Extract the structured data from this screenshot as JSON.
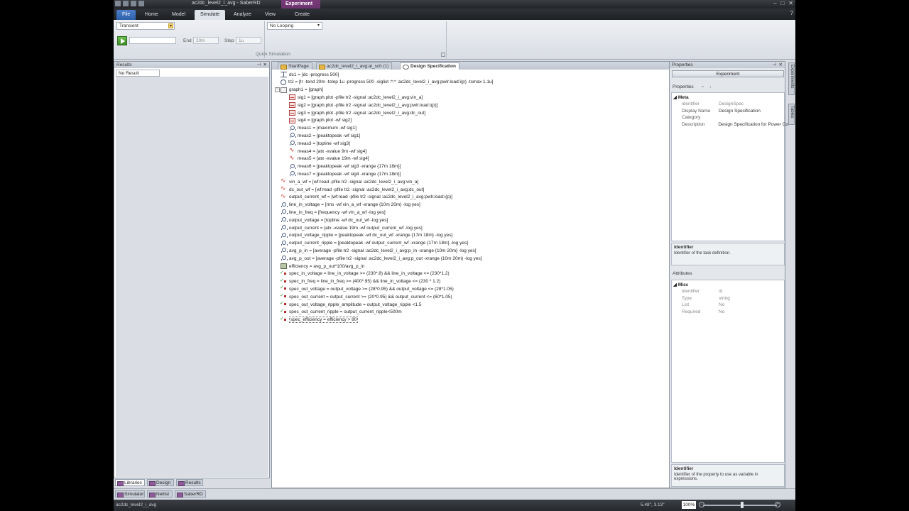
{
  "window": {
    "title": "ac2dc_level2_i_avg - SaberRD",
    "context_tab": "Experiment"
  },
  "ribbon_tabs": [
    {
      "label": "File"
    },
    {
      "label": "Home"
    },
    {
      "label": "Model"
    },
    {
      "label": "Simulate"
    },
    {
      "label": "Analyze"
    },
    {
      "label": "View"
    },
    {
      "label": "Create"
    }
  ],
  "ribbon": {
    "analysis_type": "Transient",
    "looping": "No Looping",
    "end_label": "End",
    "end_placeholder": "20m",
    "step_label": "Step",
    "step_placeholder": "1u",
    "group_label": "Quick Simulation"
  },
  "results": {
    "title": "Results",
    "tab": "No Result"
  },
  "bottom_tabs": [
    {
      "label": "Libraries"
    },
    {
      "label": "Design"
    },
    {
      "label": "Results"
    }
  ],
  "mode_tabs": [
    {
      "label": "Simulator"
    },
    {
      "label": "Netlist"
    },
    {
      "label": "SaberRD"
    }
  ],
  "doc_tabs": [
    {
      "label": "StartPage"
    },
    {
      "label": "ac2dc_level2_i_avg:ai_sch (1)"
    },
    {
      "label": "Design Specification"
    }
  ],
  "tree": [
    {
      "indent": 0,
      "icon": "dc",
      "text": "dc1 = [dc -progress 500]"
    },
    {
      "indent": 0,
      "icon": "tr",
      "text": "tr2 = [tr -tend 20m -tstep 1u -progress 500 -siglist :*:* :ac2dc_level2_i_avg:pwlr.load:i(p) -tsmax 1.1u]"
    },
    {
      "indent": 0,
      "icon": "graph",
      "text": "graph1 = [graph]",
      "expander": "−"
    },
    {
      "indent": 1,
      "icon": "sig",
      "text": "sig1 = [graph.plot -pfile tr2 -signal :ac2dc_level2_i_avg:vin_a]"
    },
    {
      "indent": 1,
      "icon": "sig",
      "text": "sig2 = [graph.plot -pfile tr2 -signal :ac2dc_level2_i_avg:pwlr.load:i(p)]"
    },
    {
      "indent": 1,
      "icon": "sig",
      "text": "sig3 = [graph.plot -pfile tr2 -signal :ac2dc_level2_i_avg:dc_out]"
    },
    {
      "indent": 1,
      "icon": "sig",
      "text": "sig4 = [graph.plot -wf sig2]"
    },
    {
      "indent": 1,
      "icon": "meas",
      "text": "meas1 = [maximum -wf sig1]"
    },
    {
      "indent": 1,
      "icon": "meas",
      "text": "meas2 = [peaktopeak -wf sig1]"
    },
    {
      "indent": 1,
      "icon": "meas",
      "text": "meas3 = [topline -wf sig3]"
    },
    {
      "indent": 1,
      "icon": "wave",
      "text": "meas4 = [atx -xvalue 9m -wf sig4]"
    },
    {
      "indent": 1,
      "icon": "wave",
      "text": "meas5 = [atx -xvalue 19m -wf sig4]"
    },
    {
      "indent": 1,
      "icon": "meas",
      "text": "meas6 = [peaktopeak -wf sig3 -xrange {17m 18m}]"
    },
    {
      "indent": 1,
      "icon": "meas",
      "text": "meas7 = [peaktopeak -wf sig4 -xrange {17m 18m}]"
    },
    {
      "indent": 0,
      "icon": "wave",
      "text": "vin_a_wf = [wf:read -pfile tr2 -signal :ac2dc_level2_i_avg:vin_a]"
    },
    {
      "indent": 0,
      "icon": "wave",
      "text": "dc_out_wf = [wf:read -pfile tr2 -signal :ac2dc_level2_i_avg:dc_out]"
    },
    {
      "indent": 0,
      "icon": "wave",
      "text": "output_current_wf = [wf:read -pfile tr2 -signal :ac2dc_level2_i_avg:pwlr.load:i(p)]"
    },
    {
      "indent": 0,
      "icon": "meas",
      "text": "line_in_voltage = [rms -wf vin_a_wf -xrange {10m 20m} -log yes]"
    },
    {
      "indent": 0,
      "icon": "meas",
      "text": "line_in_freq = [frequency -wf vin_a_wf -log yes]"
    },
    {
      "indent": 0,
      "icon": "meas",
      "text": "output_voltage = [topline -wf dc_out_wf -log yes]"
    },
    {
      "indent": 0,
      "icon": "meas",
      "text": "output_current = [atx -xvalue 19m -wf output_current_wf -log yes]"
    },
    {
      "indent": 0,
      "icon": "meas",
      "text": "output_voltage_ripple = [peaktopeak -wf dc_out_wf -xrange {17m 18m} -log yes]"
    },
    {
      "indent": 0,
      "icon": "meas",
      "text": "output_current_ripple = [peaktopeak -wf output_current_wf -xrange {17m 18m} -log yes]"
    },
    {
      "indent": 0,
      "icon": "meas",
      "text": "avg_p_in = [average -pfile tr2 -signal :ac2dc_level2_i_avg:p_in -xrange {10m 20m} -log yes]"
    },
    {
      "indent": 0,
      "icon": "meas",
      "text": "avg_p_out = [average -pfile tr2 -signal :ac2dc_level2_i_avg:p_out -xrange {10m 20m} -log yes]"
    },
    {
      "indent": 0,
      "icon": "eff",
      "text": "efficiency = avg_p_out*100/avg_p_in"
    },
    {
      "indent": 0,
      "icon": "spec",
      "text": "spec_in_voltage = line_in_voltage >= (230*.8) && line_in_voltage <= (230*1.2)"
    },
    {
      "indent": 0,
      "icon": "spec",
      "text": "spec_in_freq = line_in_freq >= (400*.95) && line_in_voltage <= (230 * 1.2)"
    },
    {
      "indent": 0,
      "icon": "spec",
      "text": "spec_out_voltage = output_voltage >= (28*0.95) && output_voltage <= (28*1.05)"
    },
    {
      "indent": 0,
      "icon": "spec",
      "text": "spec_out_current = output_current >= (20*0.95) && output_current <= (60*1.05)"
    },
    {
      "indent": 0,
      "icon": "spec",
      "text": "spec_out_voltage_ripple_amplitude = output_voltage_ripple <1.5"
    },
    {
      "indent": 0,
      "icon": "spec",
      "text": "spec_out_current_ripple = output_current_ripple<500m"
    },
    {
      "indent": 0,
      "icon": "spec",
      "text": "spec_efficiency = efficiency > 80",
      "selected": true
    }
  ],
  "properties": {
    "title": "Properties",
    "selector": "Experiment",
    "section_props": "Properties",
    "meta_label": "Meta",
    "meta_rows": [
      {
        "key": "Identifier",
        "value": "DesignSpec",
        "dim": true
      },
      {
        "key": "Display Name",
        "value": "Design Specification",
        "dim": false
      },
      {
        "key": "Category",
        "value": "",
        "dim": false
      },
      {
        "key": "Description",
        "value": "Design Specification for Power Co",
        "dim": false
      }
    ],
    "desc1_title": "Identifier",
    "desc1_text": "Identifier of the task definition.",
    "section_attrs": "Attributes",
    "misc_label": "Misc",
    "misc_rows": [
      {
        "key": "Identifier",
        "value": "id"
      },
      {
        "key": "Type",
        "value": "string"
      },
      {
        "key": "List",
        "value": "No"
      },
      {
        "key": "Required",
        "value": "No"
      }
    ],
    "desc2_title": "Identifier",
    "desc2_text": "Identifier of the property to use as variable in expressions."
  },
  "side_tabs": [
    {
      "label": "Experiments"
    },
    {
      "label": "Tables"
    }
  ],
  "status": {
    "left": "ac2dc_level2_i_avg",
    "coords": "5.48\", 3.13\"",
    "zoom": "100%"
  }
}
